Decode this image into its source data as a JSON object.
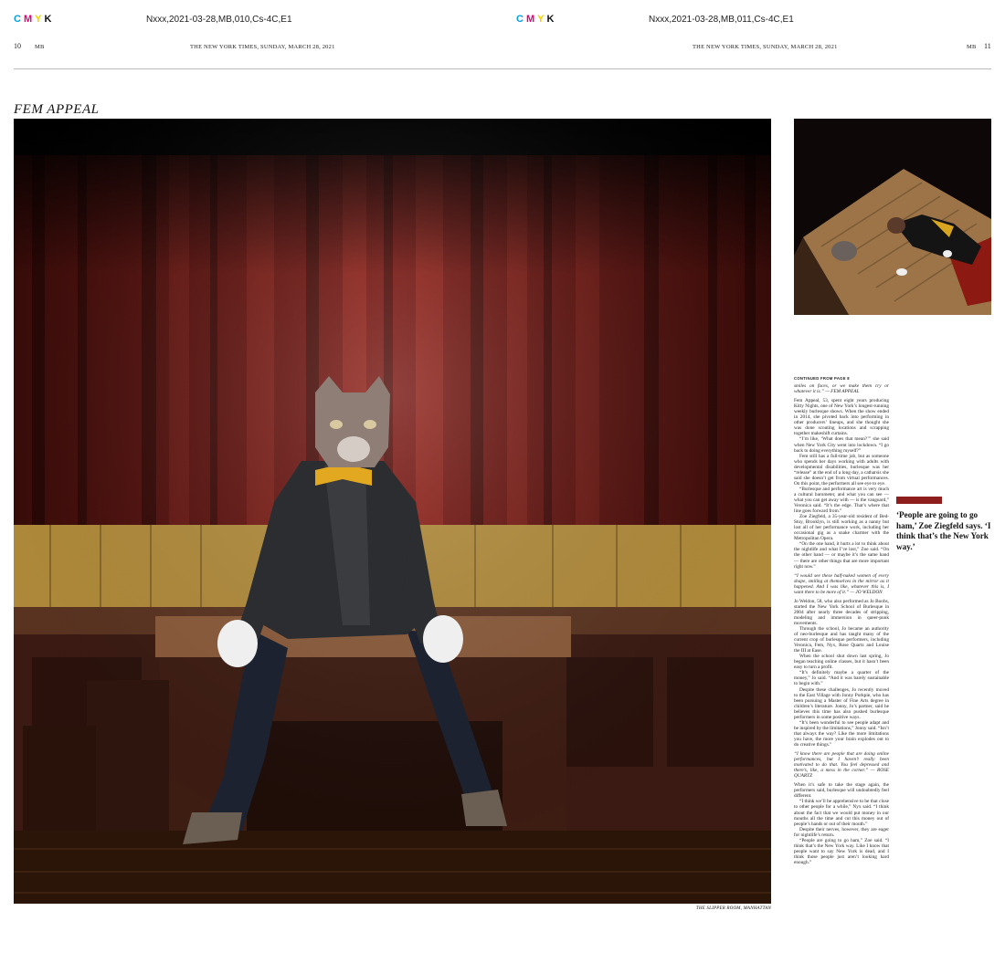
{
  "header": {
    "cmyk_left": {
      "c": "C",
      "m": "M",
      "y": "Y",
      "k": "K"
    },
    "cmyk_right": {
      "c": "C",
      "m": "M",
      "y": "Y",
      "k": "K"
    },
    "slug_left": "Nxxx,2021-03-28,MB,010,Cs-4C,E1",
    "slug_right": "Nxxx,2021-03-28,MB,011,Cs-4C,E1",
    "page_left": "10",
    "section_left": "MB",
    "dateline_left": "THE NEW YORK TIMES, SUNDAY, MARCH 28, 2021",
    "dateline_right": "THE NEW YORK TIMES, SUNDAY, MARCH 28, 2021",
    "section_right": "MB",
    "page_right": "11"
  },
  "story": {
    "headline": "FEM APPEAL",
    "main_photo_credit": "THE SLIPPER ROOM, MANHATTAN",
    "pull_quote": "‘People are going to go ham,’ Zoe Ziegfeld says. ‘I think that’s the New York way.’"
  },
  "article": {
    "kicker": "CONTINUED FROM PAGE 8",
    "lead_quote": "smiles on faces, or we make them cry or whatever it is.” — FEM APPEAL",
    "p1": "Fem Appeal, 53, spent eight years producing Kitty Nights, one of New York’s longest-running weekly burlesque shows. When the show ended in 2014, she pivoted back into performing in other producers’ lineups, and she thought she was done scouting locations and scrapping together makeshift curtains.",
    "p2": "“I’m like, ‘What does that mean?’” she said when New York City went into lockdown. “I go back to doing everything myself?”",
    "p3": "Fem still has a full-time job, but as someone who spends her days working with adults with developmental disabilities, burlesque was her “release” at the end of a long day, a catharsis she said she doesn’t get from virtual performances. On this point, the performers all see eye to eye.",
    "p4": "“Burlesque and performance art is very much a cultural barometer, and what you can see — what you can get away with — is the vanguard,” Veronica said. “It’s the edge. That’s where that line goes forward from.”",
    "p5": "Zoe Ziegfeld, a 35-year-old resident of Bed-Stuy, Brooklyn, is still working as a nanny but lost all of her performance work, including her occasional gig as a snake charmer with the Metropolitan Opera.",
    "p6": "“On the one hand, it hurts a lot to think about the nightlife and what I’ve lost,” Zoe said. “On the other hand — or maybe it’s the same hand — there are other things that are more important right now.”",
    "pq1": "“I would see these half-naked women of every shape, smiling at themselves in the mirror as it happened. And I was like, whatever this is, I want there to be more of it.” — JO WELDON",
    "p7": "Jo Weldon, 58, who also performed as Jo Boobs, started the New York School of Burlesque in 2004 after nearly three decades of stripping, modeling and immersion in queer-punk movements.",
    "p8": "Through the school, Jo became an authority of neo-burlesque and has taught many of the current crop of burlesque performers, including Veronica, Fem, Nyx, Rose Quartz and Louise the III at Ease.",
    "p9": "When the school shut down last spring, Jo began teaching online classes, but it hasn’t been easy to turn a profit.",
    "p10": "“It’s definitely maybe a quarter of the money,” Jo said. “And it was barely sustainable to begin with.”",
    "p11": "Despite these challenges, Jo recently moved to the East Village with Jonny Porkpie, who has been pursuing a Master of Fine Arts degree in children’s literature. Jonny, Jo’s partner, said he believes this time has also pushed burlesque performers in some positive ways.",
    "p12": "“It’s been wonderful to see people adapt and be inspired by the limitations,” Jonny said. “Isn’t that always the way? Like the more limitations you have, the more your brain explodes out to do creative things.”",
    "pq2": "“I know there are people that are doing online performances, but I haven’t really been motivated to do that. You feel depressed and there’s, like, a mess in the corner.” — ROSE QUARTZ",
    "p13": "When it’s safe to take the stage again, the performers said, burlesque will undoubtedly feel different.",
    "p14": "“I think we’ll be apprehensive to be that close to other people for a while,” Nyx said. “I think about the fact that we would put money in our mouths all the time and cut this money out of people’s hands or out of their mouth.”",
    "p15": "Despite their nerves, however, they are eager for nightlife’s return.",
    "p16": "“People are going to go ham,” Zoe said. “I think that’s the New York way. Like I know that people want to say New York is dead, and I think those people just aren’t looking hard enough.”"
  },
  "colors": {
    "curtain": "#7a1712",
    "accent_bar": "#8e1d1d",
    "stage_wood": "#4a2a1a"
  }
}
